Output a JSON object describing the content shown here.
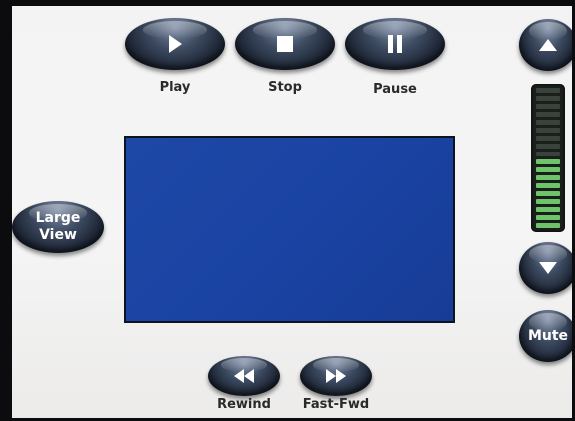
{
  "transport": {
    "play_label": "Play",
    "stop_label": "Stop",
    "pause_label": "Pause",
    "rewind_label": "Rewind",
    "fastfwd_label": "Fast-Fwd"
  },
  "view": {
    "large_view_line1": "Large",
    "large_view_line2": "View"
  },
  "volume": {
    "mute_label": "Mute",
    "level": 0.5,
    "segments_total": 18,
    "segments_lit": 9
  },
  "colors": {
    "video_area": "#1a43a3",
    "meter_on": "#6fc36a",
    "meter_off": "#3a423c",
    "button": "#1b2331"
  },
  "icons": {
    "play": "play-icon",
    "stop": "stop-icon",
    "pause": "pause-icon",
    "rewind": "rewind-icon",
    "fastfwd": "fast-forward-icon",
    "vol_up": "triangle-up-icon",
    "vol_down": "triangle-down-icon"
  }
}
